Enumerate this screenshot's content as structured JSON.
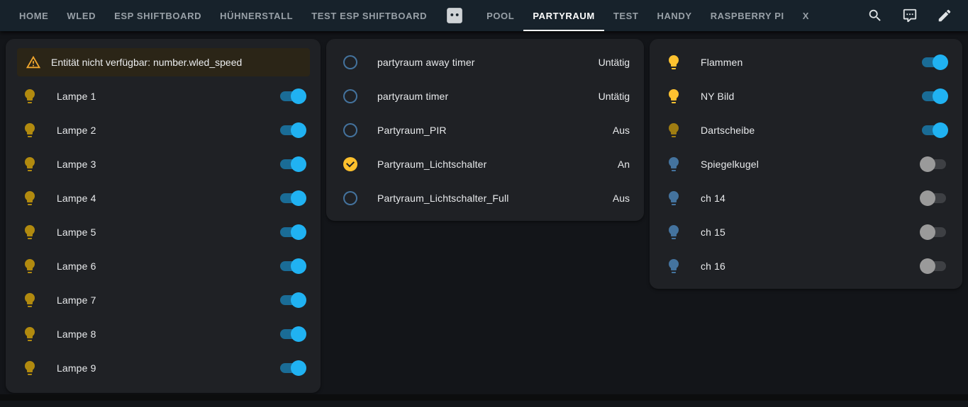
{
  "nav": {
    "tabs": [
      {
        "label": "HOME",
        "state": "normal"
      },
      {
        "label": "WLED",
        "state": "normal"
      },
      {
        "label": "ESP SHIFTBOARD",
        "state": "normal"
      },
      {
        "label": "HÜHNERSTALL",
        "state": "normal"
      },
      {
        "label": "TEST ESP SHIFTBOARD",
        "state": "normal"
      },
      {
        "label": "",
        "icon": "power-socket",
        "state": "normal"
      },
      {
        "label": "POOL",
        "state": "normal"
      },
      {
        "label": "PARTYRAUM",
        "state": "active"
      },
      {
        "label": "TEST",
        "state": "normal"
      },
      {
        "label": "HANDY",
        "state": "normal"
      },
      {
        "label": "RASPBERRY PI",
        "state": "normal"
      },
      {
        "label": "X",
        "state": "normal"
      }
    ],
    "action_icons": [
      "search-icon",
      "chat-icon",
      "edit-icon"
    ]
  },
  "colors": {
    "header_bg": "#17222b",
    "page_bg": "#131519",
    "card_bg": "#1f2125",
    "toggle_on_thumb": "#20b2f2",
    "toggle_on_track": "#1a6c96",
    "toggle_off_thumb": "#9a9a9a",
    "toggle_off_track": "#3e4044",
    "warning_bg": "#2b2517",
    "warning_icon": "#f2a72e",
    "active_tab_underline": "#ffffff"
  },
  "cards": {
    "lights_left": {
      "warning": {
        "icon": "alert-icon",
        "text": "Entität nicht verfügbar: number.wled_speed"
      },
      "rows": [
        {
          "label": "Lampe 1",
          "icon": "lightbulb",
          "icon_color": "#b18a0f",
          "toggle": "on"
        },
        {
          "label": "Lampe 2",
          "icon": "lightbulb",
          "icon_color": "#b18a0f",
          "toggle": "on"
        },
        {
          "label": "Lampe 3",
          "icon": "lightbulb",
          "icon_color": "#b18a0f",
          "toggle": "on"
        },
        {
          "label": "Lampe 4",
          "icon": "lightbulb",
          "icon_color": "#b18a0f",
          "toggle": "on"
        },
        {
          "label": "Lampe 5",
          "icon": "lightbulb",
          "icon_color": "#b18a0f",
          "toggle": "on"
        },
        {
          "label": "Lampe 6",
          "icon": "lightbulb",
          "icon_color": "#b18a0f",
          "toggle": "on"
        },
        {
          "label": "Lampe 7",
          "icon": "lightbulb",
          "icon_color": "#b18a0f",
          "toggle": "on"
        },
        {
          "label": "Lampe 8",
          "icon": "lightbulb",
          "icon_color": "#b18a0f",
          "toggle": "on"
        },
        {
          "label": "Lampe 9",
          "icon": "lightbulb",
          "icon_color": "#b18a0f",
          "toggle": "on"
        }
      ]
    },
    "sensors_middle": {
      "rows": [
        {
          "label": "partyraum away timer",
          "icon": "circle-outline",
          "icon_color": "#44739e",
          "state": "Untätig"
        },
        {
          "label": "partyraum timer",
          "icon": "circle-outline",
          "icon_color": "#44739e",
          "state": "Untätig"
        },
        {
          "label": "Partyraum_PIR",
          "icon": "circle-outline",
          "icon_color": "#44739e",
          "state": "Aus"
        },
        {
          "label": "Partyraum_Lichtschalter",
          "icon": "check-circle",
          "icon_color": "#fdc02d",
          "state": "An"
        },
        {
          "label": "Partyraum_Lichtschalter_Full",
          "icon": "circle-outline",
          "icon_color": "#44739e",
          "state": "Aus"
        }
      ]
    },
    "lights_right": {
      "rows": [
        {
          "label": "Flammen",
          "icon": "lightbulb",
          "icon_color": "#fdc230",
          "toggle": "on"
        },
        {
          "label": "NY Bild",
          "icon": "lightbulb",
          "icon_color": "#fdc230",
          "toggle": "on"
        },
        {
          "label": "Dartscheibe",
          "icon": "lightbulb",
          "icon_color": "#9f7d12",
          "toggle": "on"
        },
        {
          "label": "Spiegelkugel",
          "icon": "lightbulb",
          "icon_color": "#44739e",
          "toggle": "off"
        },
        {
          "label": "ch 14",
          "icon": "lightbulb",
          "icon_color": "#44739e",
          "toggle": "off"
        },
        {
          "label": "ch 15",
          "icon": "lightbulb",
          "icon_color": "#44739e",
          "toggle": "off"
        },
        {
          "label": "ch 16",
          "icon": "lightbulb",
          "icon_color": "#44739e",
          "toggle": "off"
        }
      ]
    }
  }
}
